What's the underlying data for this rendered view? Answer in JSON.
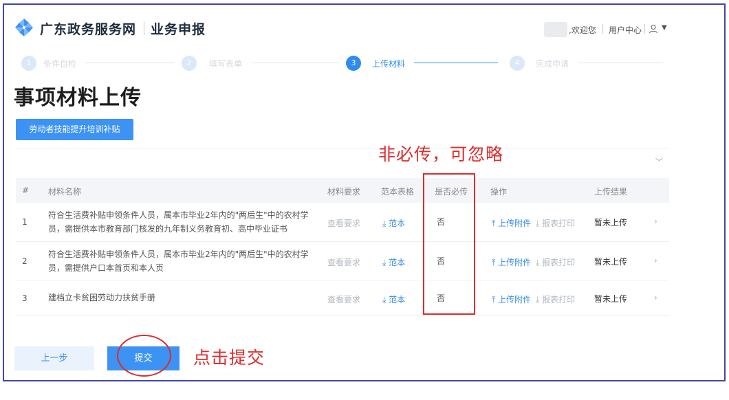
{
  "header": {
    "brand": "广东政务服务网",
    "section": "业务申报",
    "welcome": ",欢迎您",
    "user_center": "用户中心",
    "dropdown_caret": "▼"
  },
  "steps": [
    {
      "num": "1",
      "label": "条件自检",
      "state": "done"
    },
    {
      "num": "2",
      "label": "填写表单",
      "state": "done"
    },
    {
      "num": "3",
      "label": "上传材料",
      "state": "active"
    },
    {
      "num": "4",
      "label": "完成申请",
      "state": "todo"
    }
  ],
  "page_title": "事项材料上传",
  "tab_label": "劳动者技能提升培训补贴",
  "table": {
    "headers": [
      "#",
      "材料名称",
      "材料要求",
      "范本表格",
      "是否必传",
      "操作",
      "上传结果"
    ],
    "rows": [
      {
        "index": "1",
        "name": "符合生活费补贴申领条件人员，属本市毕业2年内的\"两后生\"中的农村学员，需提供本市教育部门核发的九年制义务教育初、高中毕业证书",
        "requirement": "查看要求",
        "sample": "范本",
        "required": "否",
        "upload": "上传附件",
        "print": "报表打印",
        "result": "暂未上传",
        "arrow": "›"
      },
      {
        "index": "2",
        "name": "符合生活费补贴申领条件人员，属本市毕业2年内的\"两后生\"中的农村学员，需提供户口本首页和本人页",
        "requirement": "查看要求",
        "sample": "范本",
        "required": "否",
        "upload": "上传附件",
        "print": "报表打印",
        "result": "暂未上传",
        "arrow": "›"
      },
      {
        "index": "3",
        "name": "建档立卡贫困劳动力扶贫手册",
        "requirement": "查看要求",
        "sample": "范本",
        "required": "否",
        "upload": "上传附件",
        "print": "报表打印",
        "result": "暂未上传",
        "arrow": "›"
      }
    ]
  },
  "annotations": {
    "optional_note": "非必传，可忽略",
    "submit_note": "点击提交"
  },
  "buttons": {
    "prev": "上一步",
    "submit": "提交"
  },
  "icons": {
    "logo": "pinwheel-logo-icon",
    "user": "user-icon",
    "upload": "upload-icon",
    "download": "download-icon",
    "chevron_right": "chevron-right-icon",
    "chevron_down": "chevron-down-icon"
  },
  "colors": {
    "accent": "#3d93f3",
    "annotation": "#e02a2a",
    "frame": "#3f47a8"
  }
}
